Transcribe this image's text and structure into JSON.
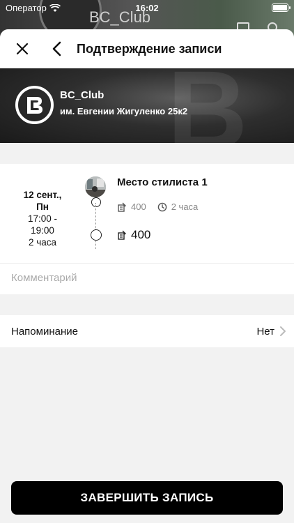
{
  "status_bar": {
    "carrier": "Оператор",
    "time": "16:02"
  },
  "background": {
    "title": "BC_Club"
  },
  "navbar": {
    "title": "Подтверждение записи"
  },
  "salon": {
    "name": "BC_Club",
    "address": "им. Евгении Жигуленко 25к2"
  },
  "booking": {
    "date": "12 сент.,",
    "weekday": "Пн",
    "time_from": "17:00 -",
    "time_to": "19:00",
    "duration": "2 часа",
    "service_name": "Место стилиста 1",
    "service_price": "400",
    "service_duration": "2 часа",
    "total_price": "400"
  },
  "comment": {
    "placeholder": "Комментарий"
  },
  "reminder": {
    "label": "Напоминание",
    "value": "Нет"
  },
  "cta": {
    "label": "ЗАВЕРШИТЬ ЗАПИСЬ"
  },
  "colors": {
    "accent": "#000000",
    "muted": "#888888",
    "sheet_bg": "#f2f2f2"
  }
}
